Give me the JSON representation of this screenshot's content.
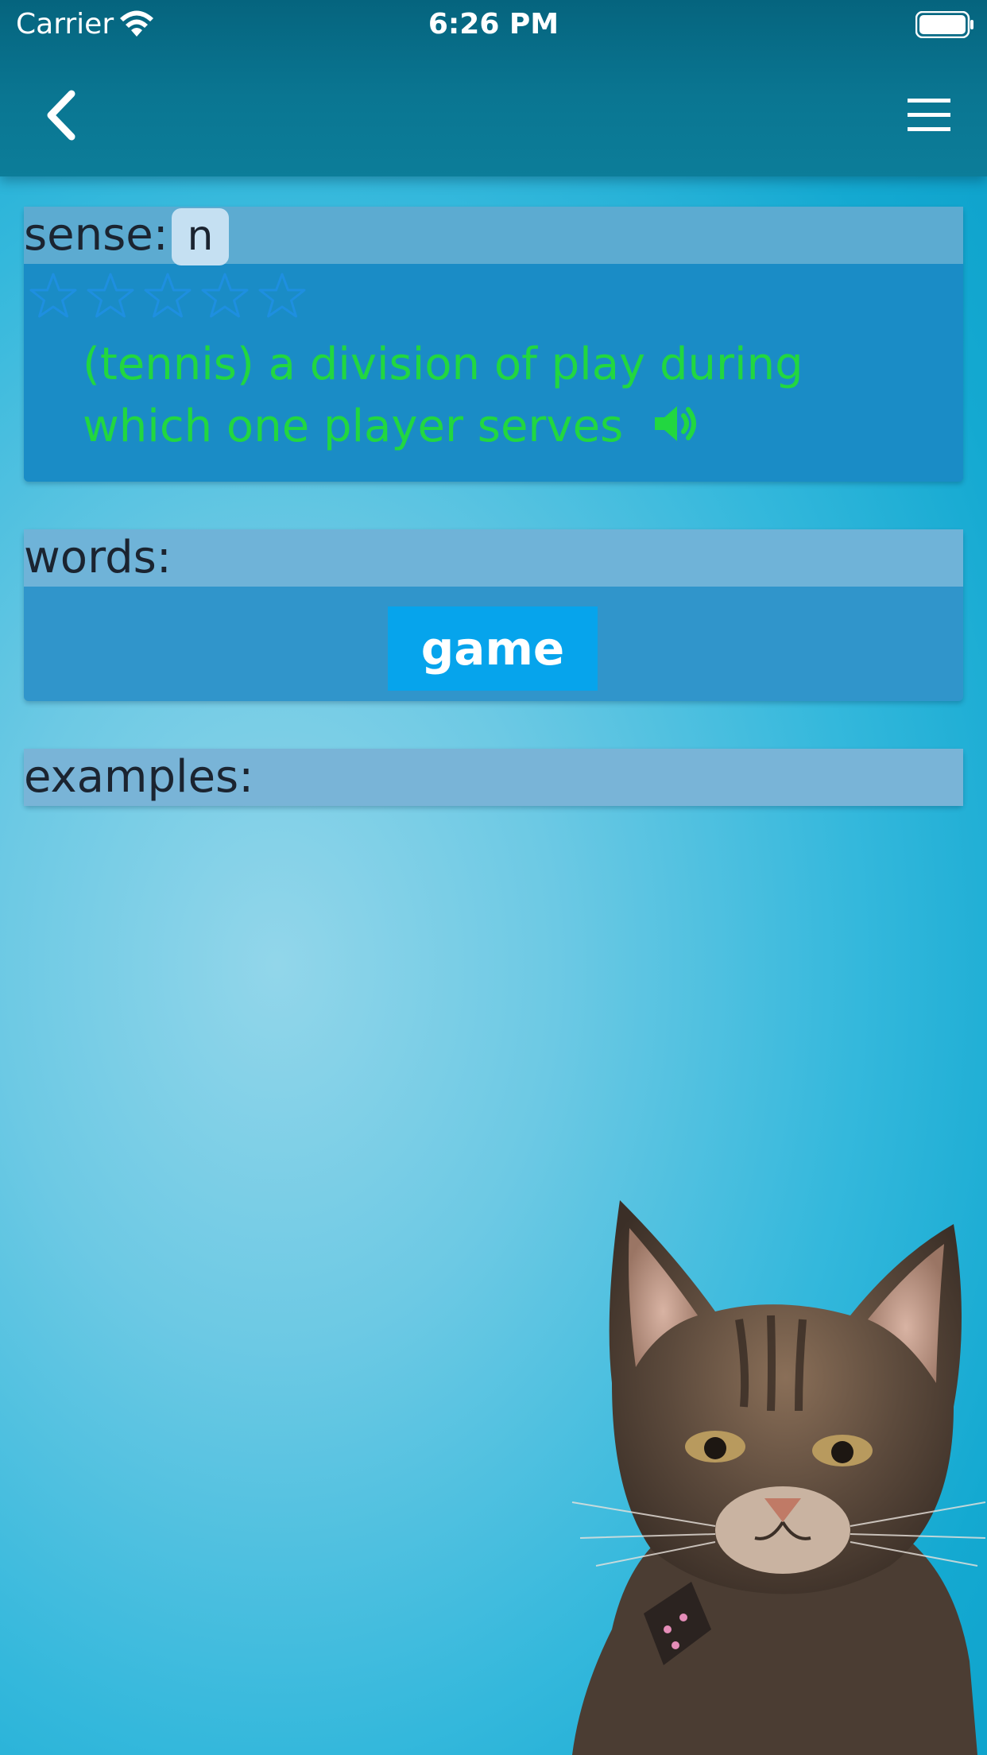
{
  "status_bar": {
    "carrier": "Carrier",
    "time": "6:26 PM",
    "wifi_icon": "wifi-icon",
    "battery_icon": "battery-full-icon"
  },
  "nav_bar": {
    "back_icon": "chevron-left-icon",
    "menu_icon": "hamburger-menu-icon"
  },
  "sense": {
    "header_label": "sense:",
    "part_of_speech": "n",
    "rating": 0,
    "rating_max": 5,
    "definition": "(tennis) a division of play during which one player serves",
    "speaker_icon": "speaker-icon"
  },
  "words": {
    "header_label": "words:",
    "items": [
      "game"
    ]
  },
  "examples": {
    "header_label": "examples:"
  },
  "colors": {
    "nav_bar": "#0a7692",
    "background": "#34b8dc",
    "definition_text": "#22d740",
    "word_chip": "#06a4ec",
    "star_outline": "#1e8fe0"
  }
}
